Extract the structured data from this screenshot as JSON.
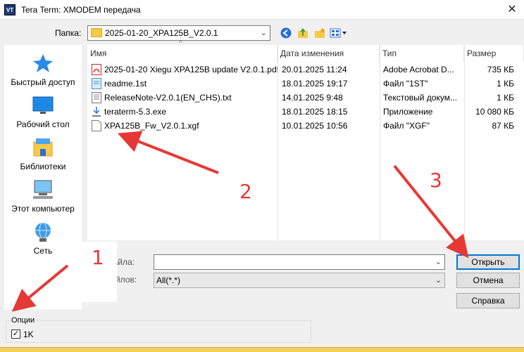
{
  "window": {
    "title": "Tera Term: XMODEM передача",
    "app_icon": "VT",
    "close": "✕"
  },
  "lookin": {
    "label": "Папка:",
    "folder": "2025-01-20_XPA125B_V2.0.1"
  },
  "places": [
    {
      "label": "Быстрый доступ",
      "icon": "star-icon"
    },
    {
      "label": "Рабочий стол",
      "icon": "desktop-icon"
    },
    {
      "label": "Библиотеки",
      "icon": "libraries-icon"
    },
    {
      "label": "Этот компьютер",
      "icon": "computer-icon"
    },
    {
      "label": "Сеть",
      "icon": "network-icon"
    }
  ],
  "columns": {
    "name": "Имя",
    "date": "Дата изменения",
    "type": "Тип",
    "size": "Размер"
  },
  "files": [
    {
      "name": "2025-01-20 Xiegu XPA125B update V2.0.1.pdf",
      "date": "20.01.2025 11:24",
      "type": "Adobe Acrobat D...",
      "size": "735 КБ",
      "icon": "pdf-icon"
    },
    {
      "name": "readme.1st",
      "date": "18.01.2025 19:17",
      "type": "Файл \"1ST\"",
      "size": "1 КБ",
      "icon": "document-icon"
    },
    {
      "name": "ReleaseNote-V2.0.1(EN_CHS).txt",
      "date": "14.01.2025 9:48",
      "type": "Текстовый докум...",
      "size": "1 КБ",
      "icon": "text-file-icon"
    },
    {
      "name": "teraterm-5.3.exe",
      "date": "18.01.2025 18:15",
      "type": "Приложение",
      "size": "10 080 КБ",
      "icon": "installer-icon"
    },
    {
      "name": "XPA125B_Fw_V2.0.1.xgf",
      "date": "10.01.2025 10:56",
      "type": "Файл \"XGF\"",
      "size": "87 КБ",
      "icon": "blank-file-icon"
    }
  ],
  "filename": {
    "label": "Имя файла:",
    "value": ""
  },
  "filetype": {
    "label": "Тип файлов:",
    "value": "All(*.*)"
  },
  "buttons": {
    "open": "Открыть",
    "cancel": "Отмена",
    "help": "Справка"
  },
  "options": {
    "legend": "Опции",
    "checkbox_label": "1K",
    "checked": true,
    "check_mark": "✓"
  },
  "annotations": {
    "one": "1",
    "two": "2",
    "three": "3",
    "color": "#e53935"
  },
  "toolbar_icons": [
    "back-icon",
    "up-folder-icon",
    "new-folder-icon",
    "view-menu-icon"
  ]
}
